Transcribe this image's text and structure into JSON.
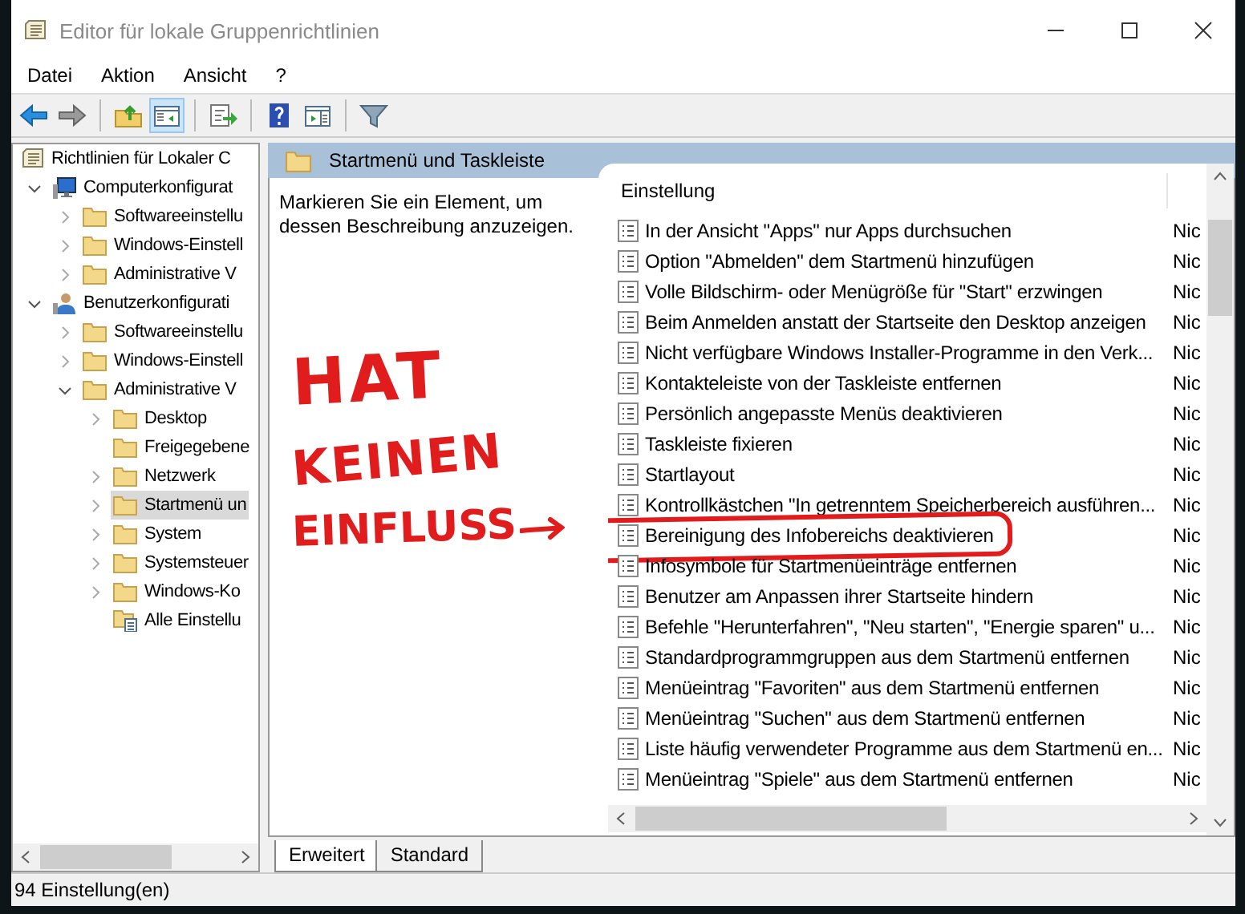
{
  "window": {
    "title": "Editor für lokale Gruppenrichtlinien"
  },
  "menu": [
    "Datei",
    "Aktion",
    "Ansicht",
    "?"
  ],
  "toolbar_groups": [
    {
      "buttons": [
        {
          "kind": "back",
          "pressed": false
        },
        {
          "kind": "forward",
          "pressed": false
        }
      ]
    },
    {
      "buttons": [
        {
          "kind": "up",
          "pressed": false
        },
        {
          "kind": "tree",
          "pressed": true
        }
      ]
    },
    {
      "buttons": [
        {
          "kind": "export",
          "pressed": false
        }
      ]
    },
    {
      "buttons": [
        {
          "kind": "help",
          "pressed": false
        },
        {
          "kind": "pane",
          "pressed": false
        }
      ]
    },
    {
      "buttons": [
        {
          "kind": "filter",
          "pressed": false
        }
      ]
    }
  ],
  "tree": [
    {
      "label": "Richtlinien für Lokaler C",
      "kind": "doc",
      "selected": false,
      "children": [
        {
          "label": "Computerkonfigurat",
          "kind": "computer",
          "expanded": true,
          "selected": false,
          "children": [
            {
              "label": "Softwareeinstellu",
              "kind": "folder",
              "expanded": false,
              "selected": false
            },
            {
              "label": "Windows-Einstell",
              "kind": "folder",
              "expanded": false,
              "selected": false
            },
            {
              "label": "Administrative V",
              "kind": "folder",
              "expanded": false,
              "selected": false
            }
          ]
        },
        {
          "label": "Benutzerkonfigurati",
          "kind": "user",
          "expanded": true,
          "selected": false,
          "children": [
            {
              "label": "Softwareeinstellu",
              "kind": "folder",
              "expanded": false,
              "selected": false
            },
            {
              "label": "Windows-Einstell",
              "kind": "folder",
              "expanded": false,
              "selected": false
            },
            {
              "label": "Administrative V",
              "kind": "folder",
              "expanded": true,
              "selected": false,
              "children": [
                {
                  "label": "Desktop",
                  "kind": "folder",
                  "expanded": false,
                  "selected": false
                },
                {
                  "label": "Freigegebene",
                  "kind": "folder",
                  "selected": false
                },
                {
                  "label": "Netzwerk",
                  "kind": "folder",
                  "expanded": false,
                  "selected": false
                },
                {
                  "label": "Startmenü un",
                  "kind": "folder",
                  "expanded": false,
                  "selected": true
                },
                {
                  "label": "System",
                  "kind": "folder",
                  "expanded": false,
                  "selected": false
                },
                {
                  "label": "Systemsteuer",
                  "kind": "folder",
                  "expanded": false,
                  "selected": false
                },
                {
                  "label": "Windows-Ko",
                  "kind": "folder",
                  "expanded": false,
                  "selected": false
                },
                {
                  "label": "Alle Einstellu",
                  "kind": "list",
                  "selected": false
                }
              ]
            }
          ]
        }
      ]
    }
  ],
  "panel": {
    "title": "Startmenü und Taskleiste",
    "description": "Markieren Sie ein Element, um dessen Beschreibung anzuzeigen."
  },
  "annotation": {
    "lines": [
      "HAT",
      "KEINEN",
      "EINFLUSS"
    ]
  },
  "table": {
    "columns": [
      "Einstellung"
    ],
    "rows": [
      {
        "setting": "In der Ansicht \"Apps\" nur Apps durchsuchen",
        "column_2": "Nic",
        "circled": false
      },
      {
        "setting": "Option \"Abmelden\" dem Startmenü hinzufügen",
        "column_2": "Nic",
        "circled": false
      },
      {
        "setting": "Volle Bildschirm- oder Menügröße für \"Start\" erzwingen",
        "column_2": "Nic",
        "circled": false
      },
      {
        "setting": "Beim Anmelden anstatt der Startseite den Desktop anzeigen",
        "column_2": "Nic",
        "circled": false
      },
      {
        "setting": "Nicht verfügbare Windows Installer-Programme in den Verk...",
        "column_2": "Nic",
        "circled": false
      },
      {
        "setting": "Kontakteleiste von der Taskleiste entfernen",
        "column_2": "Nic",
        "circled": false
      },
      {
        "setting": "Persönlich angepasste Menüs deaktivieren",
        "column_2": "Nic",
        "circled": false
      },
      {
        "setting": "Taskleiste fixieren",
        "column_2": "Nic",
        "circled": false
      },
      {
        "setting": "Startlayout",
        "column_2": "Nic",
        "circled": false
      },
      {
        "setting": "Kontrollkästchen \"In getrenntem Speicherbereich ausführen...",
        "column_2": "Nic",
        "circled": false
      },
      {
        "setting": "Bereinigung des Infobereichs deaktivieren",
        "column_2": "Nic",
        "circled": true
      },
      {
        "setting": "Infosymbole für Startmenüeinträge entfernen",
        "column_2": "Nic",
        "circled": false
      },
      {
        "setting": "Benutzer am Anpassen ihrer Startseite hindern",
        "column_2": "Nic",
        "circled": false
      },
      {
        "setting": "Befehle \"Herunterfahren\", \"Neu starten\", \"Energie sparen\" u...",
        "column_2": "Nic",
        "circled": false
      },
      {
        "setting": "Standardprogrammgruppen aus dem Startmenü entfernen",
        "column_2": "Nic",
        "circled": false
      },
      {
        "setting": "Menüeintrag \"Favoriten\" aus dem Startmenü entfernen",
        "column_2": "Nic",
        "circled": false
      },
      {
        "setting": "Menüeintrag \"Suchen\" aus dem Startmenü entfernen",
        "column_2": "Nic",
        "circled": false
      },
      {
        "setting": "Liste häufig verwendeter Programme aus dem Startmenü en...",
        "column_2": "Nic",
        "circled": false
      },
      {
        "setting": "Menüeintrag \"Spiele\" aus dem Startmenü entfernen",
        "column_2": "Nic",
        "circled": false
      }
    ]
  },
  "tabs": [
    {
      "label": "Erweitert",
      "selected": true
    },
    {
      "label": "Standard",
      "selected": false
    }
  ],
  "status_bar": "94 Einstellung(en)"
}
